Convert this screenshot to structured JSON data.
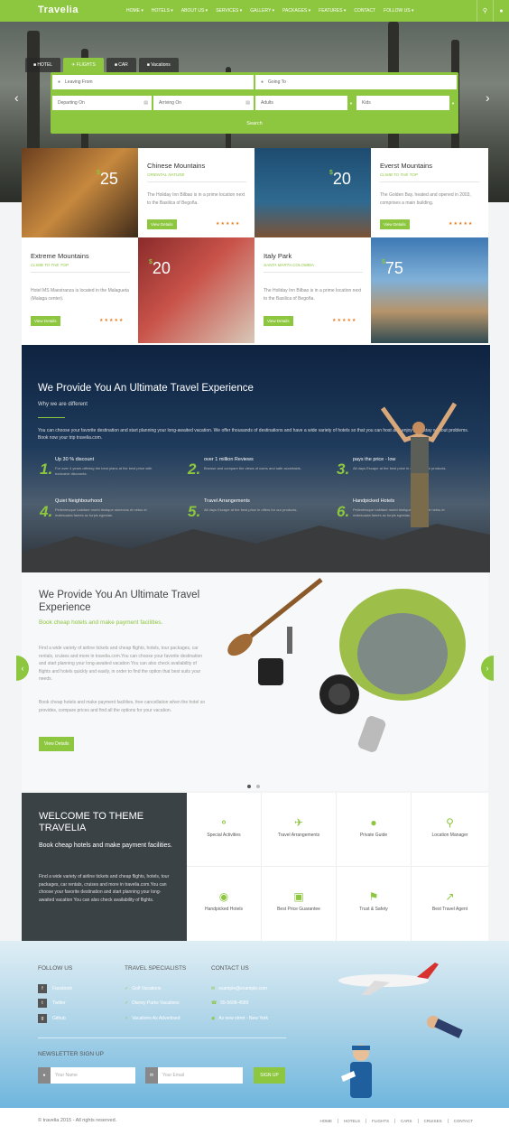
{
  "header": {
    "logo": "Travelia",
    "nav": [
      "HOME ▾",
      "HOTELS ▾",
      "ABOUT US ▾",
      "SERVICES ▾",
      "GALLERY ▾",
      "PACKAGES ▾",
      "FEATURES ▾",
      "CONTACT",
      "FOLLOW US ▾"
    ],
    "icons": [
      "search-icon",
      "user-icon"
    ]
  },
  "search": {
    "tabs": [
      "HOTEL",
      "FLIGHTS",
      "CAR",
      "Vacations"
    ],
    "active_tab": "FLIGHTS",
    "leaving_from": "Leaving From",
    "going_to": "Going To",
    "departing_on": "Departing On",
    "arriving_on": "Arriving On",
    "adults": "Adults",
    "kids": "Kids",
    "submit": "Search"
  },
  "deals": [
    {
      "title": "Chinese Mountains",
      "subtitle": "ORIENTAL NATURE",
      "price": "25",
      "desc": "The Holiday Inn Bilbao is in a prime location next to the Basilica of Begoña.",
      "button": "View Details"
    },
    {
      "title": "Everst Mountains",
      "subtitle": "CLIMB TO THE TOP",
      "price": "20",
      "desc": "The Golden Bay, heated and opened in 2003, comprises a main building.",
      "button": "View Details"
    },
    {
      "title": "Extreme Mountains",
      "subtitle": "CLIMB TO THE TOP",
      "price": "20",
      "desc": "Hotel MS Maestranza is located in the Malagueta (Malaga center).",
      "button": "View Details"
    },
    {
      "title": "Italy Park",
      "subtitle": "SANTA MARTA COLOMBIA",
      "price": "75",
      "desc": "The Holiday Inn Bilbao is in a prime location next to the Basilica of Begoña.",
      "button": "View Details"
    }
  ],
  "currency": "$",
  "experience": {
    "title": "We Provide You An Ultimate Travel Experience",
    "subtitle": "Why we are different",
    "text": "You can choose your favorite destination and start planning your long-awaited vacation. We offer thousands of destinations and have a wide variety of hotels so that you can host and enjoy your stay without problems. Book now your trip travelia.com.",
    "features": [
      {
        "n": "1.",
        "t": "Up 30 % discount",
        "d": "For over 4 years offering the best plans at the best price with exclusive discounts."
      },
      {
        "n": "2.",
        "t": "over 1 million Reviews",
        "d": "Browse and compare the views of users and safe accertaids."
      },
      {
        "n": "3.",
        "t": "pays the price - low",
        "d": "All days Escape at the best price in offers for our products."
      },
      {
        "n": "4.",
        "t": "Quiet Neighbourhood",
        "d": "Pellentesque habitant morbi tristique senectus et netus et malesuada fames ac turpis egestas."
      },
      {
        "n": "5.",
        "t": "Travel Arrangements",
        "d": "All days Escape at the best price in offers for our products."
      },
      {
        "n": "6.",
        "t": "Handpicked Hotels",
        "d": "Pellentesque habitant morbi tristique senectus et netus et malesuada fames ac turpis egestas."
      }
    ]
  },
  "gear": {
    "title": "We Provide You An Ultimate Travel Experience",
    "lead": "Book cheap hotels and make payment facilities.",
    "p1": "Find a wide variety of airline tickets and cheap flights, hotels, tour packages, car rentals, cruises and more in travelia.com.You can choose your favorite destination and start planning your long-awaited vacation You can also check availability of flights and hotels quickly and easily, in order to find the option that best suits your needs.",
    "p2": "Book cheap hotels and make payment facilities, free cancellation when the hotel so provides, compare prices and find all the options for your vacation.",
    "button": "View Details"
  },
  "welcome": {
    "title": "WELCOME TO THEME TRAVELIA",
    "lead": "Book cheap hotels and make payment facilities.",
    "text": "Find a wide variety of airline tickets and cheap flights, hotels, tour packages, car rentals, cruises and more in travelia.com.You can choose your favorite destination and start planning your long-awaited vacation You can also check availability of flights."
  },
  "services": [
    {
      "icon": "bicycle-icon",
      "label": "Special Activities"
    },
    {
      "icon": "plane-icon",
      "label": "Travel Arrangements"
    },
    {
      "icon": "guide-icon",
      "label": "Private Guide"
    },
    {
      "icon": "location-icon",
      "label": "Location Manager"
    },
    {
      "icon": "map-marker-icon",
      "label": "Handpicked Hotels"
    },
    {
      "icon": "money-icon",
      "label": "Best Price Guarantee"
    },
    {
      "icon": "bank-icon",
      "label": "Trust & Safety"
    },
    {
      "icon": "chart-icon",
      "label": "Best Travel Agent"
    }
  ],
  "footer": {
    "follow_title": "FOLLOW US",
    "follow": [
      "Facebook",
      "Twitter",
      "Github"
    ],
    "specialists_title": "TRAVEL SPECIALISTS",
    "specialists": [
      "Golf Vacations",
      "Disney Parks Vacations",
      "Vacations As Advertised"
    ],
    "contact_title": "CONTACT US",
    "contact": [
      "example@example.com",
      "55-5698-4589",
      "Av new strret - New York"
    ],
    "newsletter_title": "NEWSLETTER SIGN UP",
    "name_placeholder": "Your Name",
    "email_placeholder": "Your Email",
    "signup": "SIGN UP"
  },
  "bottom": {
    "copy": "© travelia 2015 - All rights reserved.",
    "links": [
      "HOME",
      "HOTELS",
      "FLIGHTS",
      "CARS",
      "CRUISES",
      "CONTACT"
    ]
  },
  "colors": {
    "accent": "#8dc63f",
    "dark": "#3b4246"
  }
}
